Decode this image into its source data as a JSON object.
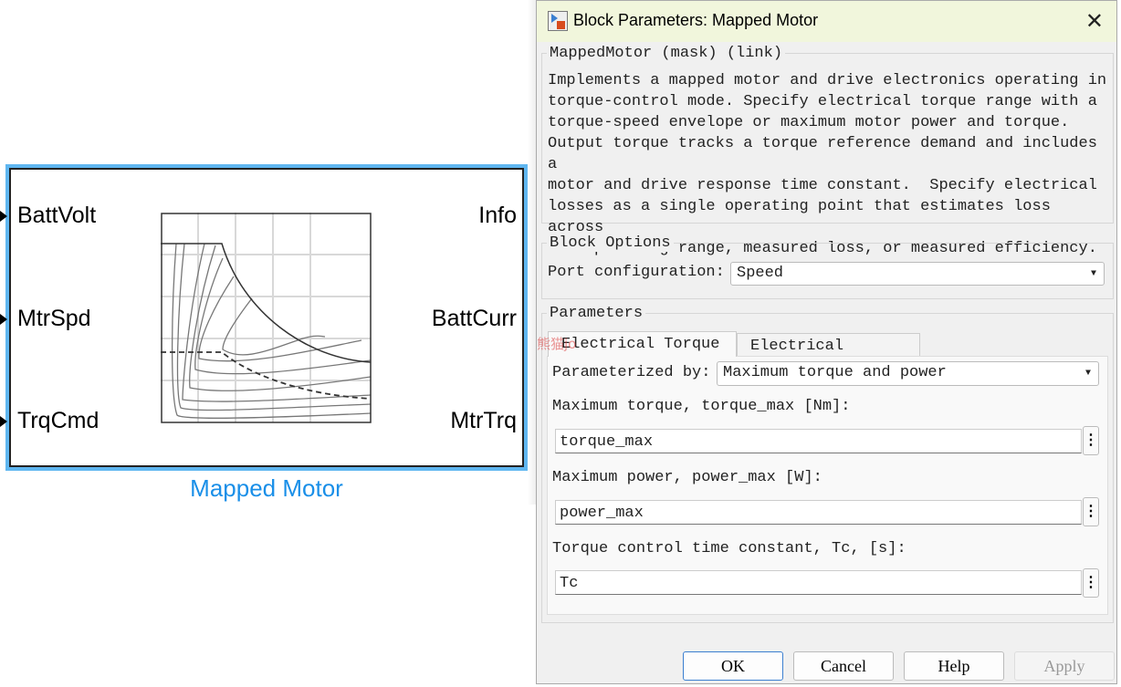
{
  "block": {
    "name": "Mapped Motor",
    "inputs": [
      "BattVolt",
      "MtrSpd",
      "TrqCmd"
    ],
    "outputs": [
      "Info",
      "BattCurr",
      "MtrTrq"
    ],
    "icon": "torque-speed-efficiency-map-icon",
    "colors": {
      "selection": "#5fb6f0",
      "name": "#1a8fe8"
    }
  },
  "dialog": {
    "title": "Block Parameters: Mapped Motor",
    "icon": "simulink-block-icon",
    "mask_label": "MappedMotor (mask) (link)",
    "description": "Implements a mapped motor and drive electronics operating in\ntorque-control mode. Specify electrical torque range with a\ntorque-speed envelope or maximum motor power and torque.\nOutput torque tracks a torque reference demand and includes a\nmotor and drive response time constant.  Specify electrical\nlosses as a single operating point that estimates loss across\nthe operating range, measured loss, or measured efficiency.",
    "block_options": {
      "label": "Block Options",
      "port_config_label": "Port configuration:",
      "port_config_value": "Speed"
    },
    "parameters": {
      "label": "Parameters",
      "tabs": [
        {
          "label": "Electrical Torque",
          "active": true
        },
        {
          "label": "Electrical Losses",
          "active": false
        }
      ],
      "parameterized_label": "Parameterized by:",
      "parameterized_value": "Maximum torque and power",
      "fields": [
        {
          "label": "Maximum torque, torque_max [Nm]:",
          "value": "torque_max"
        },
        {
          "label": "Maximum power, power_max [W]:",
          "value": "power_max"
        },
        {
          "label": "Torque control time constant, Tc, [s]:",
          "value": "Tc"
        }
      ]
    },
    "buttons": {
      "ok": "OK",
      "cancel": "Cancel",
      "help": "Help",
      "apply": "Apply"
    },
    "watermark": "熊猫jo"
  }
}
